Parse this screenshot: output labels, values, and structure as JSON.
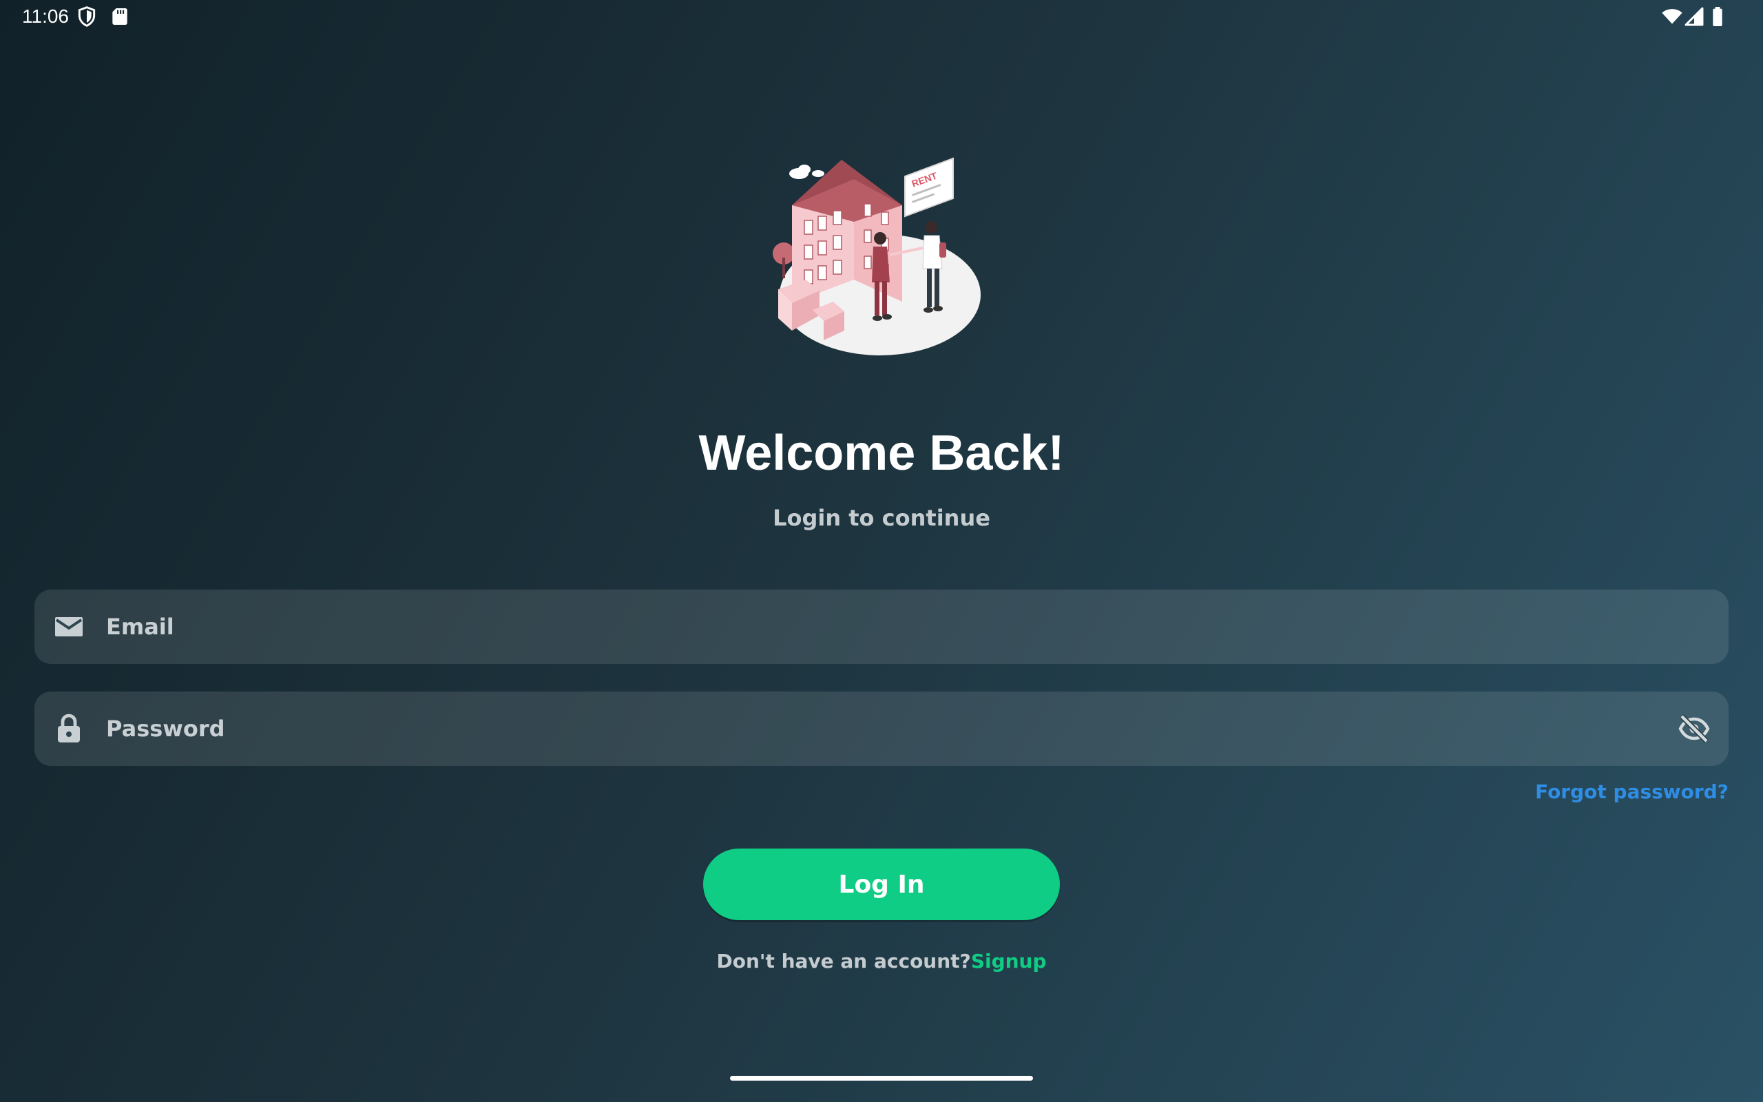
{
  "status_bar": {
    "time": "11:06",
    "left_icons": [
      "shield-icon",
      "sd-card-icon"
    ],
    "right_icons": [
      "wifi-icon",
      "cell-signal-icon",
      "battery-icon"
    ]
  },
  "illustration": {
    "icon": "rent-building-illustration",
    "sign_text": "RENT"
  },
  "header": {
    "title": "Welcome Back!",
    "subtitle": "Login to continue"
  },
  "form": {
    "email": {
      "placeholder": "Email",
      "value": "",
      "icon": "mail-icon"
    },
    "password": {
      "placeholder": "Password",
      "value": "",
      "icon": "lock-icon",
      "toggle_icon": "eye-off-icon"
    },
    "forgot_label": "Forgot password?",
    "login_label": "Log In",
    "signup_prompt": "Don't have an account?",
    "signup_label": "Signup"
  },
  "colors": {
    "accent": "#0fcd84",
    "link": "#2f8de4",
    "background_start": "#112129",
    "background_end": "#2a5165"
  }
}
